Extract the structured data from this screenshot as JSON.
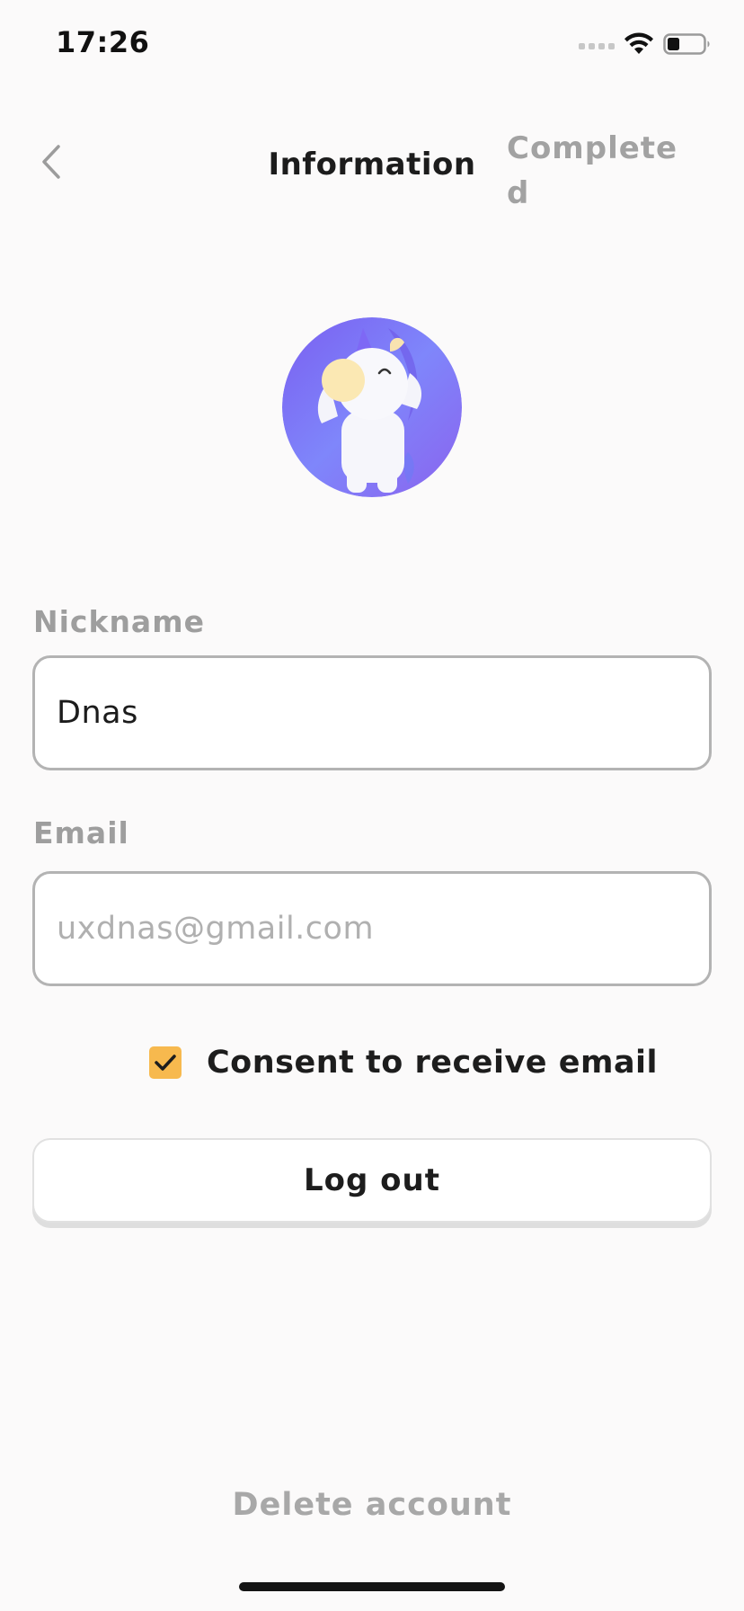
{
  "status_bar": {
    "time": "17:26",
    "icons": [
      "cellular-signal-icon",
      "wifi-icon",
      "battery-icon"
    ]
  },
  "nav": {
    "back_icon": "chevron-left-icon",
    "title": "Information",
    "complete_label": "Complete​d"
  },
  "avatar": {
    "icon": "unicorn-avatar-icon",
    "background_colors": [
      "#7b63f2",
      "#8a84ff"
    ]
  },
  "form": {
    "nickname": {
      "label": "Nickname",
      "value": "Dnas"
    },
    "email": {
      "label": "Email",
      "value": "uxdnas@gmail.com"
    },
    "consent": {
      "label": "Consent to receive email",
      "checked": true,
      "check_color": "#f7b94e"
    }
  },
  "actions": {
    "logout_label": "Log out",
    "delete_label": "Delete account"
  }
}
